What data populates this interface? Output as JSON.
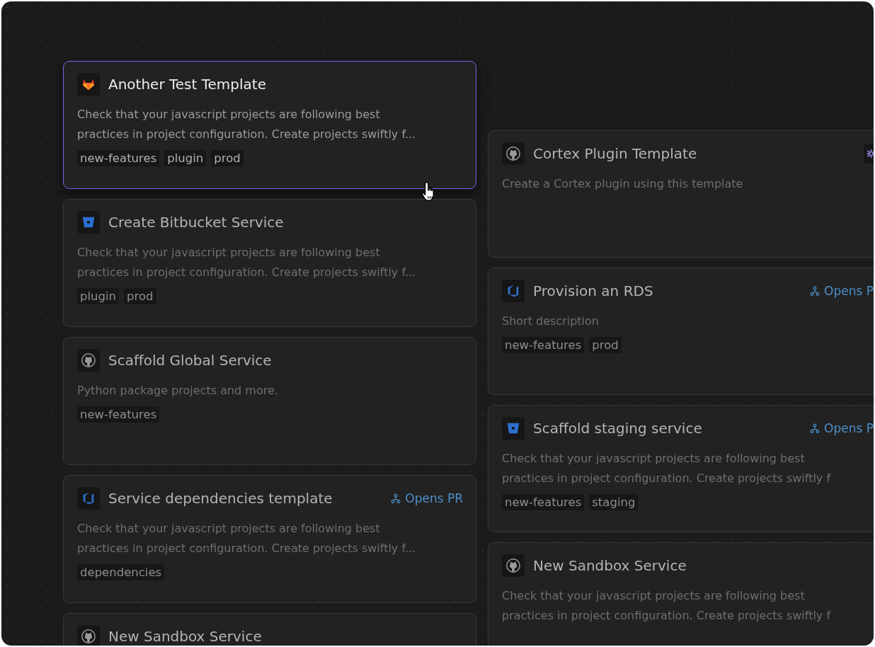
{
  "columns": [
    {
      "cards": [
        {
          "title": "Another Test Template",
          "kind": "gitlab",
          "selected": true,
          "plugin_badge": false,
          "description": [
            "Check that your javascript projects are following best",
            "practices in project configuration. Create projects swiftly f..."
          ],
          "tags": [
            "new-features",
            "plugin",
            "prod"
          ]
        },
        {
          "title": "Create Bitbucket Service",
          "kind": "bitbucket",
          "selected": false,
          "plugin_badge": false,
          "description": [
            "Check that your javascript projects are following best",
            "practices in project configuration. Create projects swiftly f..."
          ],
          "tags": [
            "plugin",
            "prod"
          ]
        },
        {
          "title": "Scaffold Global Service",
          "kind": "github",
          "selected": false,
          "plugin_badge": false,
          "description": [
            "Python package projects and more."
          ],
          "tags": [
            "new-features"
          ]
        },
        {
          "title": "Service dependencies template",
          "kind": "azure",
          "selected": false,
          "plugin_badge": false,
          "badge": "Opens PR",
          "description": [
            "Check that your javascript projects are following best",
            "practices in project configuration. Create projects swiftly f..."
          ],
          "tags": [
            "dependencies"
          ]
        },
        {
          "title": "New Sandbox Service",
          "kind": "github",
          "selected": false,
          "plugin_badge": false
        }
      ]
    },
    {
      "cards": [
        {
          "title": "Cortex Plugin Template",
          "kind": "github",
          "selected": false,
          "plugin_badge": true,
          "description": [
            "Create a Cortex plugin using this template"
          ]
        },
        {
          "title": "Provision an RDS",
          "kind": "azure",
          "selected": false,
          "plugin_badge": false,
          "badge": "Opens P",
          "description": [
            "Short description"
          ],
          "tags": [
            "new-features",
            "prod"
          ]
        },
        {
          "title": "Scaffold staging service",
          "kind": "bitbucket",
          "selected": false,
          "plugin_badge": false,
          "badge": "Opens P",
          "description": [
            "Check that your javascript projects are following best",
            "practices in project configuration. Create projects swiftly f"
          ],
          "tags": [
            "new-features",
            "staging"
          ]
        },
        {
          "title": "New Sandbox Service",
          "kind": "github",
          "selected": false,
          "plugin_badge": false,
          "description": [
            "Check that your javascript projects are following best",
            "practices in project configuration. Create projects swiftly f"
          ]
        }
      ]
    }
  ]
}
